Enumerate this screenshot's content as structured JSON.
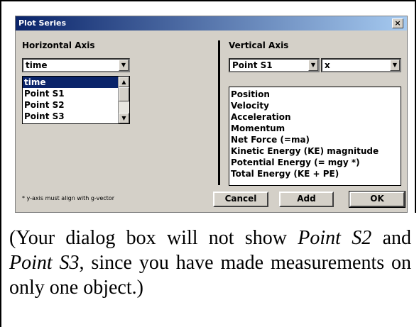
{
  "dialog": {
    "title": "Plot Series",
    "close_glyph": "×",
    "horizontal": {
      "label": "Horizontal Axis",
      "selected": "time",
      "list": [
        "time",
        "Point S1",
        "Point S2",
        "Point S3"
      ]
    },
    "vertical": {
      "label": "Vertical Axis",
      "point_selected": "Point S1",
      "component_selected": "x",
      "quantities": [
        "Position",
        "Velocity",
        "Acceleration",
        "Momentum",
        "Net Force (=ma)",
        "Kinetic Energy (KE) magnitude",
        "Potential Energy (= mgy *)",
        "Total Energy (KE + PE)"
      ]
    },
    "note": "* y-axis must align with g-vector",
    "buttons": {
      "cancel": "Cancel",
      "add": "Add",
      "ok": "OK"
    }
  },
  "caption": {
    "part1": "(Your dialog box will not show ",
    "em1": "Point S2",
    "part2": " and ",
    "em2": "Point S3",
    "part3": ", since you have made measurements on only one object.)"
  }
}
